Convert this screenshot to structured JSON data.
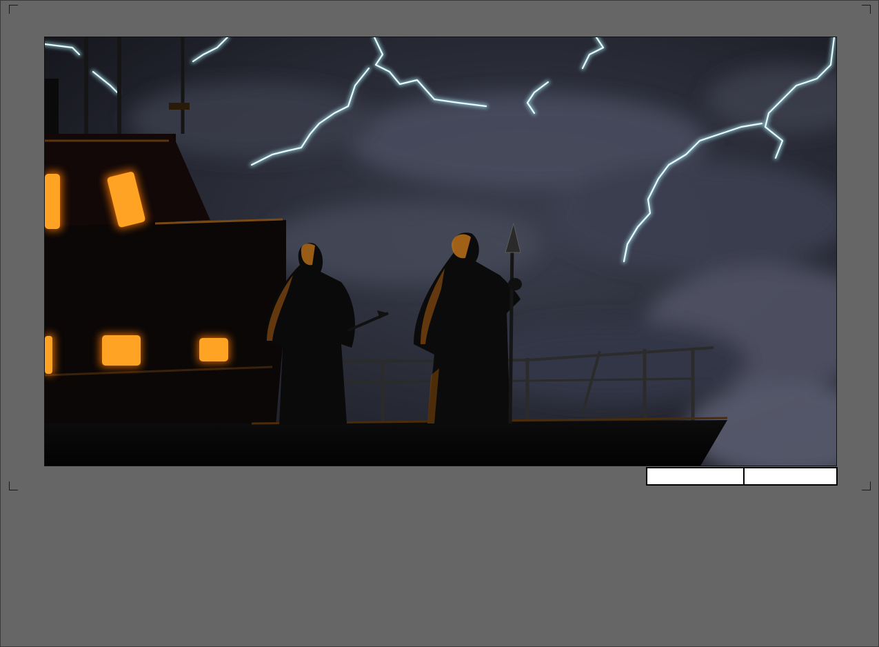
{
  "scene": {
    "description_icon": "storm-ship-scene",
    "colors": {
      "sky": "#2a2c38",
      "cloud": "#4a4d5e",
      "lightning": "#dff4f6",
      "window_glow": "#ff9a10",
      "silhouette": "#070707"
    }
  },
  "fields": {
    "field_1_value": "",
    "field_2_value": ""
  }
}
